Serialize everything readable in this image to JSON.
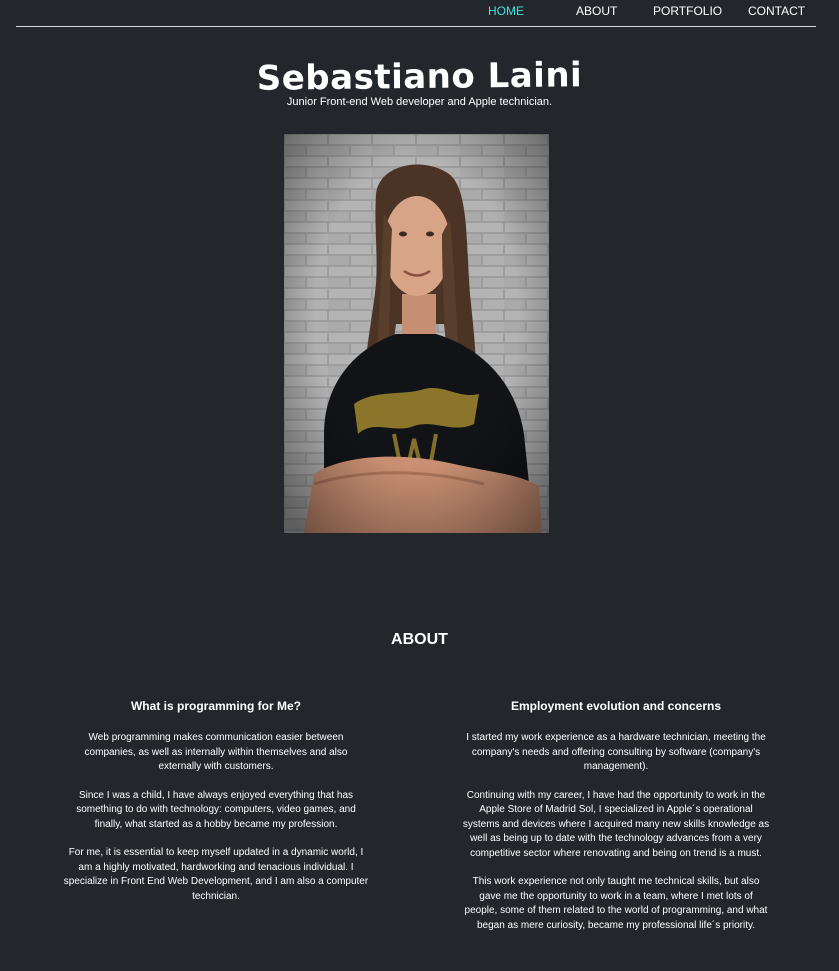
{
  "nav": {
    "items": [
      {
        "label": "HOME",
        "active": true
      },
      {
        "label": "ABOUT",
        "active": false
      },
      {
        "label": "PORTFOLIO",
        "active": false
      },
      {
        "label": "CONTACT",
        "active": false
      }
    ],
    "active_color": "#3fe3e3"
  },
  "hero": {
    "name": "Sebastiano Laini",
    "tagline": "Junior Front-end Web developer and Apple technician."
  },
  "about": {
    "heading": "ABOUT",
    "left": {
      "title": "What is programming for Me?",
      "paragraphs": [
        "Web programming makes communication easier between companies, as well as internally within themselves and also externally with customers.",
        "Since I was a child, I have always enjoyed everything that has something to do with technology: computers, video games, and finally, what started as a hobby became my profession.",
        "For me, it is essential to keep myself updated in a dynamic world, I am a highly motivated, hardworking and tenacious individual. I specialize in Front End Web Development, and I am also a computer technician."
      ]
    },
    "right": {
      "title": "Employment evolution and concerns",
      "paragraphs": [
        "I started my work experience as a hardware technician, meeting the company's needs and offering consulting by software (company's management).",
        "Continuing with my career, I have had the opportunity to work in the Apple Store of Madrid Sol, I specialized in Apple´s operational systems and devices where I acquired many new skills knowledge as well as being up to date with the technology advances from a very competitive sector where renovating and being on trend is a must.",
        "This work experience not only taught me technical skills, but also gave me the opportunity to work in a team, where I met lots of people, some of them related to the world of programming, and what began as mere curiosity, became my professional life´s priority."
      ]
    }
  },
  "colors": {
    "background": "#23272c",
    "text": "#ffffff",
    "rule": "#d8d8d8"
  }
}
